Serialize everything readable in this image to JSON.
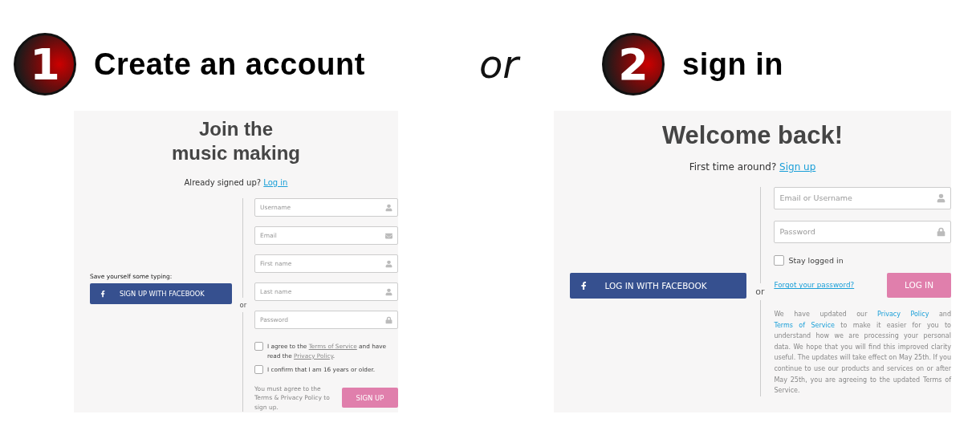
{
  "header": {
    "steps": [
      {
        "number": "1",
        "label": "Create an account"
      },
      {
        "number": "2",
        "label": "sign in"
      }
    ],
    "separator": "or"
  },
  "signup": {
    "title_lines": [
      "Join the",
      "music making"
    ],
    "subtitle": {
      "text": "Already signed up? ",
      "link": "Log in"
    },
    "facebook_hint": "Save yourself some typing:",
    "facebook_button": "SIGN UP WITH FACEBOOK",
    "or": "or",
    "fields": [
      {
        "kind": "user",
        "placeholder": "Username"
      },
      {
        "kind": "email",
        "placeholder": "Email"
      },
      {
        "kind": "user",
        "placeholder": "First name"
      },
      {
        "kind": "user",
        "placeholder": "Last name"
      },
      {
        "kind": "password",
        "placeholder": "Password"
      }
    ],
    "checkboxes": [
      {
        "checked": false,
        "parts": [
          {
            "kind": "text",
            "text": "I agree to the "
          },
          {
            "kind": "link",
            "text": "Terms of Service"
          },
          {
            "kind": "text",
            "text": " and have read the "
          },
          {
            "kind": "link",
            "text": "Privacy Policy"
          },
          {
            "kind": "text",
            "text": "."
          }
        ]
      },
      {
        "checked": false,
        "parts": [
          {
            "kind": "text",
            "text": "I confirm that I am 16 years or older."
          }
        ]
      }
    ],
    "note": "You must agree to the Terms & Privacy Policy to sign up.",
    "submit": "SIGN UP"
  },
  "signin": {
    "title": "Welcome back!",
    "subtitle": {
      "text": "First time around? ",
      "link": "Sign up"
    },
    "facebook_button": "LOG IN WITH FACEBOOK",
    "or": "or",
    "fields": [
      {
        "kind": "user",
        "placeholder": "Email or Username"
      },
      {
        "kind": "password",
        "placeholder": "Password"
      }
    ],
    "stay_logged_in": {
      "label": "Stay logged in",
      "checked": false
    },
    "forgot": "Forgot your password?",
    "submit": "LOG IN",
    "notice": [
      {
        "kind": "text",
        "text": "We have updated our "
      },
      {
        "kind": "link",
        "text": "Privacy Policy"
      },
      {
        "kind": "text",
        "text": " and "
      },
      {
        "kind": "link",
        "text": "Terms of Service"
      },
      {
        "kind": "text",
        "text": " to make it easier for you to understand how we are processing your personal data. We hope that you will find this improved clarity useful. The updates will take effect on May 25th. If you continue to use our products and services on or after May 25th, you are agreeing to the updated Terms of Service."
      }
    ]
  }
}
